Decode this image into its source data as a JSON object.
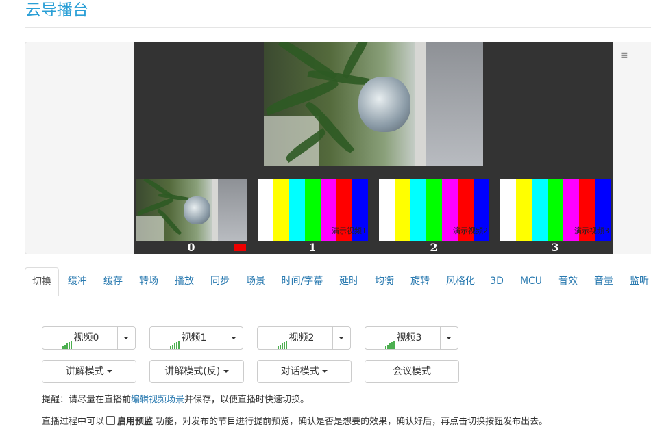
{
  "header": {
    "title": "云导播台"
  },
  "monitor": {
    "menu_icon": "≡",
    "main_preview_icon": "camera-feed",
    "thumbnails": [
      {
        "number": "0",
        "type": "camera",
        "label": ""
      },
      {
        "number": "1",
        "type": "colorbars",
        "label": "演示视频1"
      },
      {
        "number": "2",
        "type": "colorbars",
        "label": "演示视频2"
      },
      {
        "number": "3",
        "type": "colorbars",
        "label": "演示视频3"
      }
    ],
    "colorbar_colors": [
      "#ffffff",
      "#ffff00",
      "#00ffff",
      "#00ff00",
      "#ff00ff",
      "#ff0000",
      "#0000ff"
    ],
    "recording_color": "#ee0000"
  },
  "tabs": [
    {
      "label": "切换",
      "active": true
    },
    {
      "label": "缓冲"
    },
    {
      "label": "缓存"
    },
    {
      "label": "转场"
    },
    {
      "label": "播放"
    },
    {
      "label": "同步"
    },
    {
      "label": "场景"
    },
    {
      "label": "时间/字幕"
    },
    {
      "label": "延时"
    },
    {
      "label": "均衡"
    },
    {
      "label": "旋转"
    },
    {
      "label": "风格化"
    },
    {
      "label": "3D"
    },
    {
      "label": "MCU"
    },
    {
      "label": "音效"
    },
    {
      "label": "音量"
    },
    {
      "label": "监听"
    }
  ],
  "switch_panel": {
    "video_buttons": [
      {
        "label": "视频0"
      },
      {
        "label": "视频1"
      },
      {
        "label": "视频2"
      },
      {
        "label": "视频3"
      }
    ],
    "mode_buttons": [
      {
        "label": "讲解模式",
        "dropdown": true
      },
      {
        "label": "讲解模式(反)",
        "dropdown": true
      },
      {
        "label": "对话模式",
        "dropdown": true
      },
      {
        "label": "会议模式",
        "dropdown": false
      }
    ],
    "hint": {
      "prefix": "提醒：请尽量在直播前",
      "link": "编辑视频场景",
      "suffix": "并保存，以便直播时快速切换。"
    },
    "preview_hint": {
      "prefix": "直播过程中可以",
      "option": "启用预监",
      "suffix": " 功能，对发布的节目进行提前预览，确认是否是想要的效果，确认好后，再点击切换按钮发布出去。"
    }
  },
  "colors": {
    "accent": "#2a9fd6",
    "link": "#2a7ab0",
    "signal": "#4caf50"
  }
}
